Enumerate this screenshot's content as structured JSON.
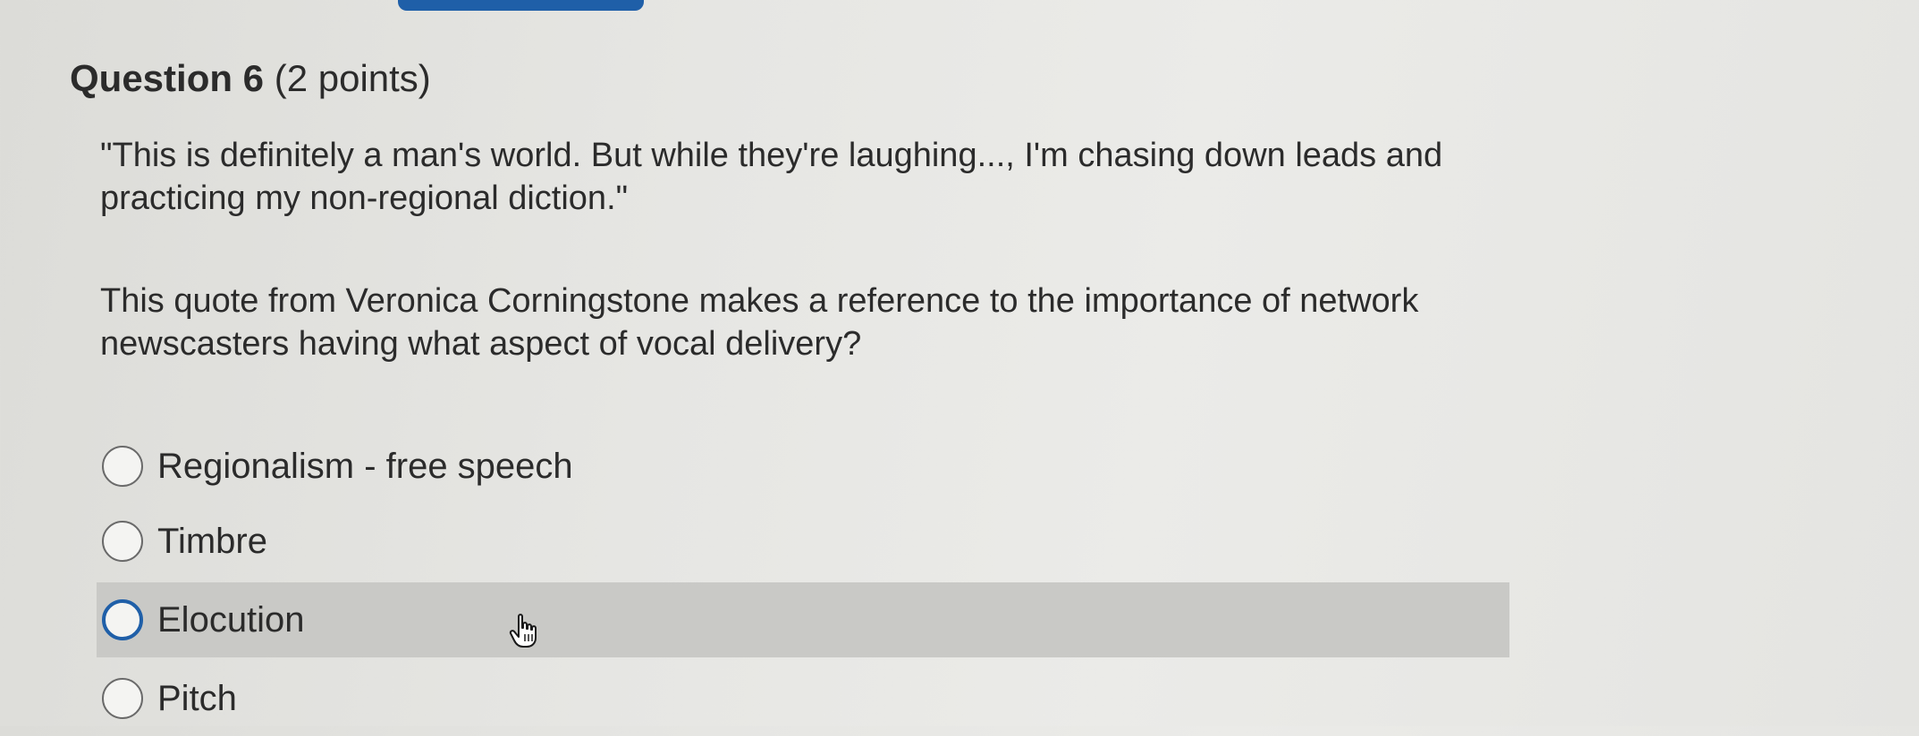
{
  "question": {
    "number_label": "Question 6",
    "points_label": "(2 points)",
    "quote": "\"This is definitely a man's world. But while they're laughing..., I'm chasing down leads and practicing my non-regional diction.\"",
    "prompt": "This quote from Veronica Corningstone makes a reference to the importance of network newscasters having what aspect of vocal delivery?",
    "options": [
      {
        "label": "Regionalism - free speech",
        "selected": false
      },
      {
        "label": "Timbre",
        "selected": false
      },
      {
        "label": "Elocution",
        "selected": true
      },
      {
        "label": "Pitch",
        "selected": false
      }
    ]
  },
  "colors": {
    "accent": "#1f5fa8",
    "highlight": "#c9c9c6"
  },
  "icons": {
    "cursor": "hand-pointer-icon"
  }
}
